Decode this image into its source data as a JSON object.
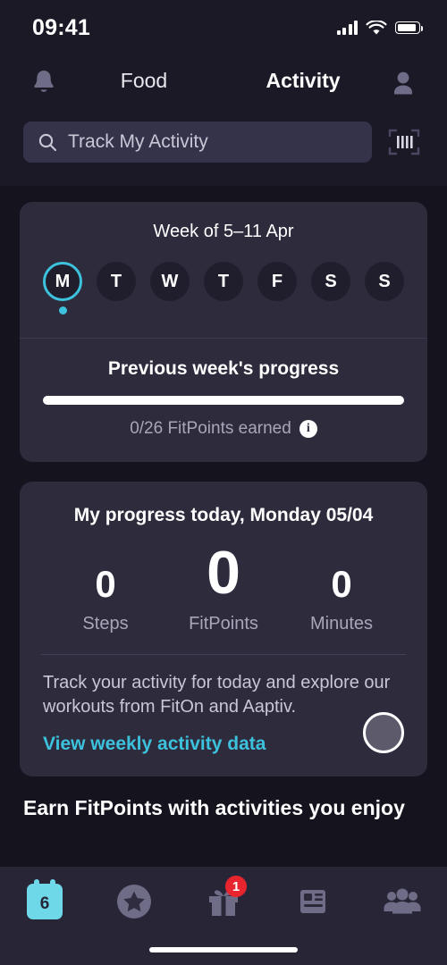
{
  "status_bar": {
    "time": "09:41",
    "signal_icon": "cellular-signal-icon",
    "wifi_icon": "wifi-icon",
    "battery_icon": "battery-icon"
  },
  "header": {
    "notifications_icon": "bell-icon",
    "profile_icon": "avatar-icon",
    "tabs": [
      {
        "label": "Food",
        "active": false
      },
      {
        "label": "Activity",
        "active": true
      }
    ],
    "active_tab_color": "#3dc2dd",
    "inactive_tab_color": "#6c6a7d"
  },
  "search": {
    "placeholder": "Track My Activity",
    "value": "",
    "search_icon": "search-icon",
    "scan_icon": "barcode-scan-icon"
  },
  "week_card": {
    "title": "Week of 5–11 Apr",
    "days": [
      {
        "letter": "M",
        "selected": true
      },
      {
        "letter": "T",
        "selected": false
      },
      {
        "letter": "W",
        "selected": false
      },
      {
        "letter": "T",
        "selected": false
      },
      {
        "letter": "F",
        "selected": false
      },
      {
        "letter": "S",
        "selected": false
      },
      {
        "letter": "S",
        "selected": false
      }
    ],
    "previous_week": {
      "title": "Previous week's progress",
      "progress_percent": 100,
      "progress_color": "#ffffff",
      "summary": "0/26 FitPoints earned",
      "info_icon": "info-icon",
      "info_glyph": "i"
    }
  },
  "today_card": {
    "title": "My progress today, Monday 05/04",
    "stats": [
      {
        "value": "0",
        "label": "Steps",
        "size": "side"
      },
      {
        "value": "0",
        "label": "FitPoints",
        "size": "center"
      },
      {
        "value": "0",
        "label": "Minutes",
        "size": "side"
      }
    ],
    "description": "Track your activity for today and explore our workouts from FitOn and Aaptiv.",
    "link_label": "View weekly activity data",
    "link_color": "#3dc2dd",
    "action_button_icon": "circle-button-icon"
  },
  "banner": {
    "title": "Earn FitPoints with activities you enjoy"
  },
  "bottom_nav": {
    "items": [
      {
        "icon": "calendar-icon",
        "day_number": "6",
        "active": true,
        "badge": null
      },
      {
        "icon": "star-circle-icon",
        "active": false,
        "badge": null
      },
      {
        "icon": "gift-icon",
        "active": false,
        "badge": "1"
      },
      {
        "icon": "news-article-icon",
        "active": false,
        "badge": null
      },
      {
        "icon": "community-group-icon",
        "active": false,
        "badge": null
      }
    ],
    "active_color": "#6fd8e8",
    "badge_color": "#e8252f",
    "home_indicator": "home-indicator"
  }
}
